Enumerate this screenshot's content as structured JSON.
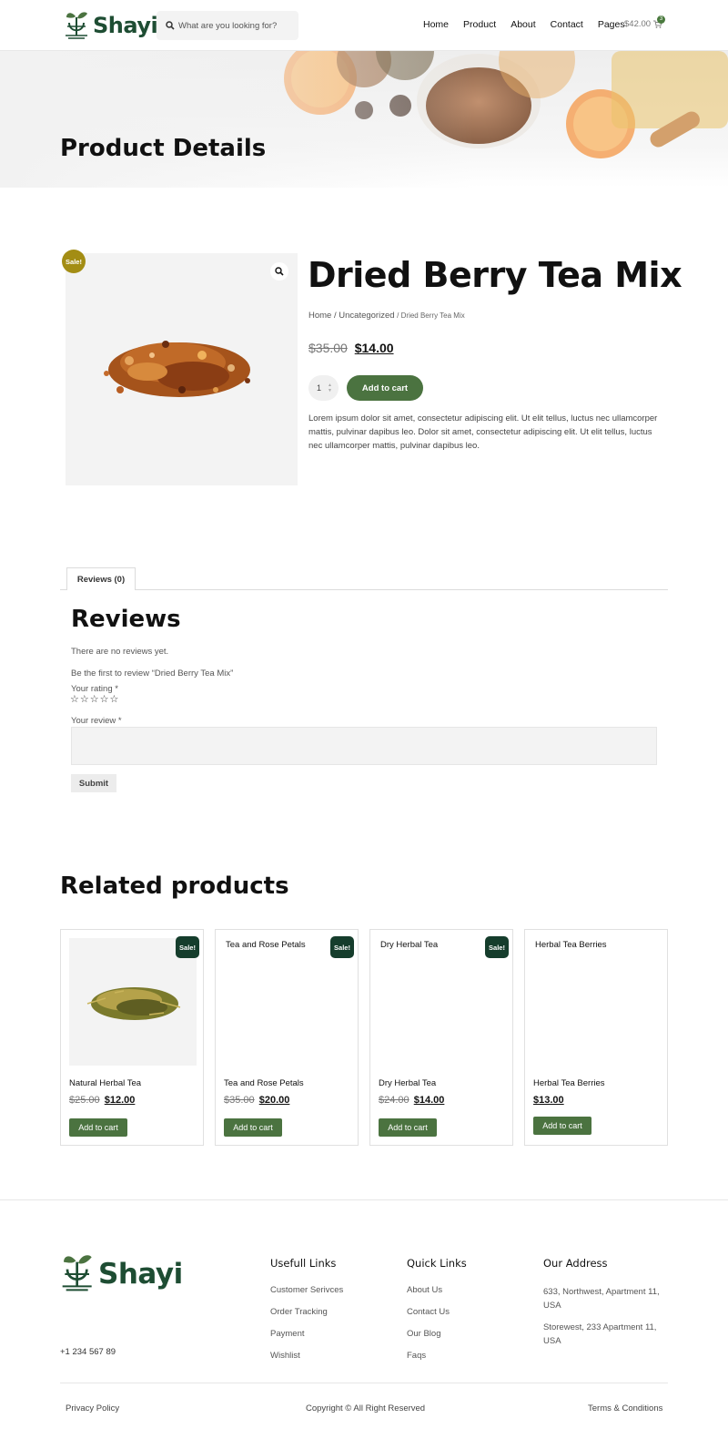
{
  "header": {
    "brand": "Shayi",
    "search_placeholder": "What are you looking for?",
    "nav": [
      "Home",
      "Product",
      "About",
      "Contact",
      "Pages"
    ],
    "cart_total": "$42.00",
    "cart_count": "3"
  },
  "hero": {
    "title": "Product Details"
  },
  "product": {
    "sale_badge": "Sale!",
    "title": "Dried Berry Tea Mix",
    "breadcrumb": [
      "Home",
      "Uncategorized",
      "Dried Berry Tea Mix"
    ],
    "old_price": "$35.00",
    "price": "$14.00",
    "quantity": "1",
    "add_label": "Add to cart",
    "description": "Lorem ipsum dolor sit amet, consectetur adipiscing elit. Ut elit tellus, luctus nec ullamcorper mattis, pulvinar dapibus leo. Dolor sit amet, consectetur adipiscing elit. Ut elit tellus, luctus nec ullamcorper mattis, pulvinar dapibus leo."
  },
  "reviews": {
    "tab_label": "Reviews (0)",
    "heading": "Reviews",
    "none_text": "There are no reviews yet.",
    "first_text": "Be the first to review “Dried Berry Tea Mix”",
    "rating_label": "Your rating *",
    "stars": "☆☆☆☆☆",
    "review_label": "Your review *",
    "submit_label": "Submit"
  },
  "related": {
    "heading": "Related products",
    "items": [
      {
        "name": "Natural Herbal Tea",
        "alt_title": "",
        "badge": "Sale!",
        "old_price": "$25.00",
        "price": "$12.00",
        "add_label": "Add to cart"
      },
      {
        "name": "Tea and Rose Petals",
        "alt_title": "Tea and Rose Petals",
        "badge": "Sale!",
        "old_price": "$35.00",
        "price": "$20.00",
        "add_label": "Add to cart"
      },
      {
        "name": "Dry Herbal Tea",
        "alt_title": "Dry Herbal Tea",
        "badge": "Sale!",
        "old_price": "$24.00",
        "price": "$14.00",
        "add_label": "Add to cart"
      },
      {
        "name": "Herbal Tea Berries",
        "alt_title": "Herbal Tea Berries",
        "badge": "",
        "old_price": "",
        "price": "$13.00",
        "add_label": "Add to cart"
      }
    ]
  },
  "footer": {
    "brand": "Shayi",
    "phone": "+1 234 567 89",
    "useful": {
      "title": "Usefull Links",
      "links": [
        "Customer Serivces",
        "Order Tracking",
        "Payment",
        "Wishlist"
      ]
    },
    "quick": {
      "title": "Quick Links",
      "links": [
        "About Us",
        "Contact Us",
        "Our Blog",
        "Faqs"
      ]
    },
    "address": {
      "title": "Our Address",
      "lines": [
        "633, Northwest, Apartment 11, USA",
        "Storewest, 233 Apartment 11, USA"
      ]
    },
    "privacy": "Privacy Policy",
    "copyright": "Copyright © All Right Reserved",
    "terms": "Terms & Conditions"
  },
  "colors": {
    "brand_green": "#1e4d33",
    "button_green": "#4b7340",
    "sale_gold": "#a38d14",
    "badge_dark": "#153d2c"
  }
}
